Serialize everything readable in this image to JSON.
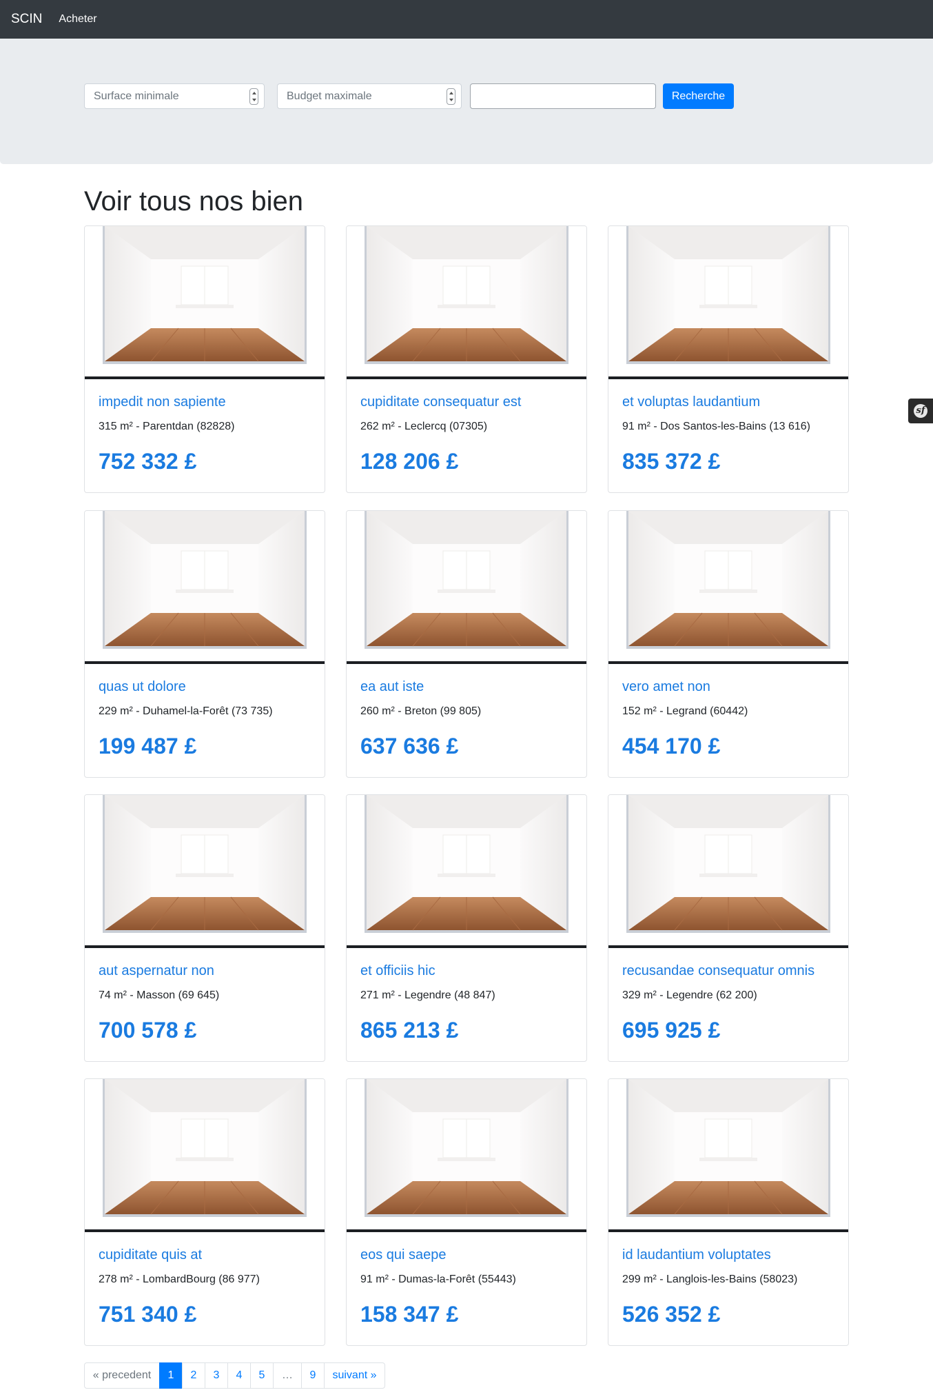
{
  "navbar": {
    "brand": "SCIN",
    "link": "Acheter"
  },
  "search": {
    "surface_placeholder": "Surface minimale",
    "budget_placeholder": "Budget maximale",
    "text_value": "",
    "button_label": "Recherche"
  },
  "page_title": "Voir tous nos bien",
  "listings": [
    {
      "title": "impedit non sapiente",
      "details": "315 m² - Parentdan (82828)",
      "price": "752 332 £"
    },
    {
      "title": "cupiditate consequatur est",
      "details": "262 m² - Leclercq (07305)",
      "price": "128 206 £"
    },
    {
      "title": "et voluptas laudantium",
      "details": "91 m² - Dos Santos-les-Bains (13 616)",
      "price": "835 372 £"
    },
    {
      "title": "quas ut dolore",
      "details": "229 m² - Duhamel-la-Forêt (73 735)",
      "price": "199 487 £"
    },
    {
      "title": "ea aut iste",
      "details": "260 m² - Breton (99 805)",
      "price": "637 636 £"
    },
    {
      "title": "vero amet non",
      "details": "152 m² - Legrand (60442)",
      "price": "454 170 £"
    },
    {
      "title": "aut aspernatur non",
      "details": "74 m² - Masson (69 645)",
      "price": "700 578 £"
    },
    {
      "title": "et officiis hic",
      "details": "271 m² - Legendre (48 847)",
      "price": "865 213 £"
    },
    {
      "title": "recusandae consequatur omnis",
      "details": "329 m² - Legendre (62 200)",
      "price": "695 925 £"
    },
    {
      "title": "cupiditate quis at",
      "details": "278 m² - LombardBourg (86 977)",
      "price": "751 340 £"
    },
    {
      "title": "eos qui saepe",
      "details": "91 m² - Dumas-la-Forêt (55443)",
      "price": "158 347 £"
    },
    {
      "title": "id laudantium voluptates",
      "details": "299 m² - Langlois-les-Bains (58023)",
      "price": "526 352 £"
    }
  ],
  "pagination": {
    "prev": "« precedent",
    "pages": [
      "1",
      "2",
      "3",
      "4",
      "5",
      "…",
      "9"
    ],
    "next": "suivant »",
    "current": "1"
  },
  "icons": {
    "debug_toolbar": "symfony-icon",
    "room_image": "empty-room-image"
  },
  "colors": {
    "navbar": "#343a40",
    "accent": "#007bff",
    "jumbotron": "#e9ecef"
  }
}
